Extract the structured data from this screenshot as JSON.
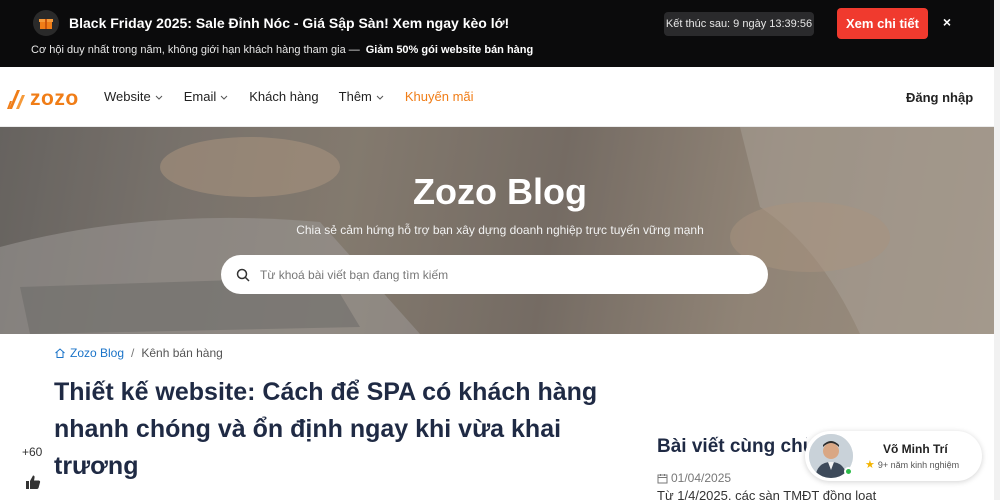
{
  "promo": {
    "title": "Black Friday 2025: Sale Đỉnh Nóc - Giá Sập Sàn! Xem ngay kèo lớ!",
    "subtitle": "Cơ hội duy nhất trong năm, không giới hạn khách hàng tham gia —",
    "subtitle_highlight": "Giảm 50% gói website bán hàng",
    "countdown": "Kết thúc sau: 9 ngày 13:39:56",
    "cta_label": "Xem chi tiết",
    "close_label": "×"
  },
  "nav": {
    "logo_text": "zozo",
    "items": [
      {
        "label": "Website",
        "has_dropdown": true
      },
      {
        "label": "Email",
        "has_dropdown": true
      },
      {
        "label": "Khách hàng",
        "has_dropdown": false
      },
      {
        "label": "Thêm",
        "has_dropdown": true
      },
      {
        "label": "Khuyến mãi",
        "has_dropdown": false
      }
    ],
    "login_label": "Đăng nhập",
    "accent": "#f07d17"
  },
  "hero": {
    "title": "Zozo Blog",
    "subtitle": "Chia sẻ cảm hứng hỗ trợ bạn xây dựng doanh nghiệp trực tuyến vững mạnh",
    "search_placeholder": "Từ khoá bài viết bạn đang tìm kiếm"
  },
  "breadcrumb": {
    "home": "Zozo Blog",
    "separator": "/",
    "current": "Kênh bán hàng"
  },
  "article": {
    "title": "Thiết kế website: Cách để SPA có khách hàng nhanh chóng và ổn định ngay khi vừa khai trương"
  },
  "share": {
    "count": "+60"
  },
  "related": {
    "title": "Bài viết cùng chủ đề",
    "date": "01/04/2025",
    "excerpt": "Từ 1/4/2025, các sàn TMĐT đồng loạt"
  },
  "author": {
    "name": "Võ Minh Trí",
    "experience": "9+ năm kinh nghiệm"
  }
}
